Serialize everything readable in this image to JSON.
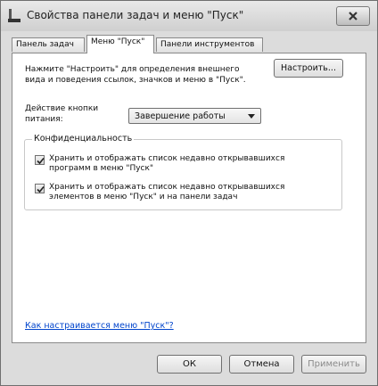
{
  "window": {
    "title": "Свойства панели задач и меню \"Пуск\"",
    "close_label": "×"
  },
  "tabs": [
    {
      "label": "Панель задач",
      "active": false
    },
    {
      "label": "Меню \"Пуск\"",
      "active": true
    },
    {
      "label": "Панели инструментов",
      "active": false
    }
  ],
  "main": {
    "description": "Нажмите \"Настроить\" для определения внешнего вида и поведения ссылок, значков и меню в \"Пуск\".",
    "configure_label": "Настроить...",
    "power_label": "Действие кнопки питания:",
    "power_value": "Завершение работы",
    "privacy": {
      "title": "Конфиденциальность",
      "items": [
        {
          "label": "Хранить и отображать список недавно открывавшихся программ в меню \"Пуск\"",
          "checked": true
        },
        {
          "label": "Хранить и отображать список недавно открывавшихся элементов в меню \"Пуск\" и на панели задач",
          "checked": true
        }
      ]
    },
    "help_link": "Как настраивается меню \"Пуск\"?"
  },
  "footer": {
    "ok": "ОК",
    "cancel": "Отмена",
    "apply": "Применить"
  }
}
